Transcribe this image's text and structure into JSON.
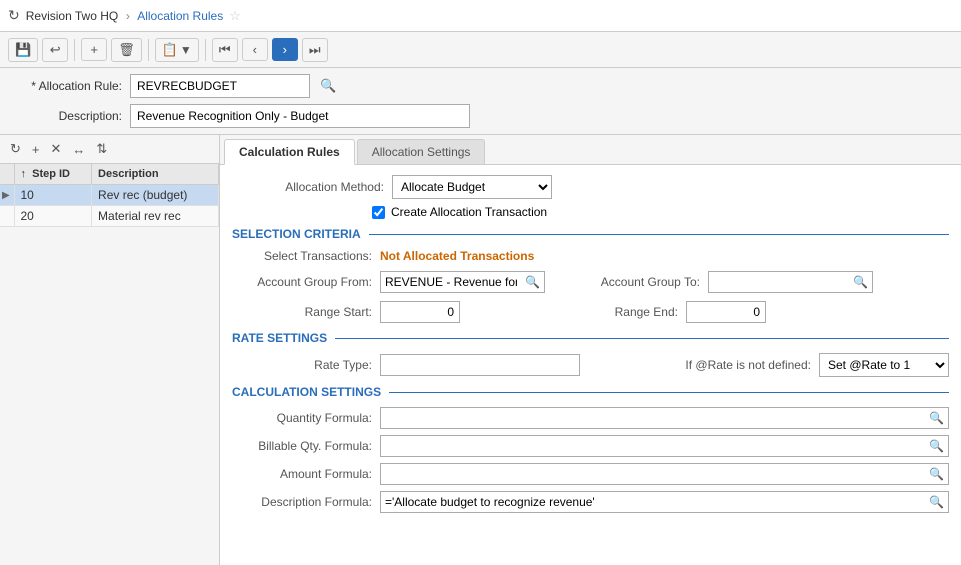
{
  "topbar": {
    "company": "Revision Two HQ",
    "separator": "›",
    "page": "Allocation Rules",
    "star": "☆",
    "refresh_icon": "↻"
  },
  "toolbar": {
    "save": "💾",
    "undo": "↩",
    "add": "+",
    "delete": "🗑",
    "copy_icon": "📋",
    "copy_arrow": "▼",
    "first": "⏮",
    "prev": "‹",
    "next": "›",
    "last": "⏭"
  },
  "header": {
    "rule_label": "* Allocation Rule:",
    "rule_value": "REVRECBUDGET",
    "desc_label": "Description:",
    "desc_value": "Revenue Recognition Only - Budget"
  },
  "left": {
    "toolbar": {
      "refresh": "↻",
      "add": "+",
      "delete": "✕",
      "expand": "↔",
      "sort": "⇅"
    },
    "columns": {
      "arrow": "",
      "step": "↑  Step ID",
      "description": "Description"
    },
    "rows": [
      {
        "selected": true,
        "arrow": "▶",
        "step": "10",
        "description": "Rev rec (budget)"
      },
      {
        "selected": false,
        "arrow": "",
        "step": "20",
        "description": "Material rev rec"
      }
    ]
  },
  "tabs": [
    {
      "id": "calc-rules",
      "label": "Calculation Rules",
      "active": true
    },
    {
      "id": "alloc-settings",
      "label": "Allocation Settings",
      "active": false
    }
  ],
  "calc_rules": {
    "allocation_method_label": "Allocation Method:",
    "allocation_method_value": "Allocate Budget",
    "create_transaction_label": "Create Allocation Transaction",
    "sections": {
      "selection": "SELECTION CRITERIA",
      "rate": "RATE SETTINGS",
      "calculation": "CALCULATION SETTINGS"
    },
    "select_transactions_label": "Select Transactions:",
    "select_transactions_value": "Not Allocated Transactions",
    "account_group_from_label": "Account Group From:",
    "account_group_from_value": "REVENUE - Revenue for p",
    "account_group_to_label": "Account Group To:",
    "account_group_to_value": "",
    "range_start_label": "Range Start:",
    "range_start_value": "0",
    "range_end_label": "Range End:",
    "range_end_value": "0",
    "rate_type_label": "Rate Type:",
    "rate_type_value": "",
    "if_rate_label": "If @Rate is not defined:",
    "if_rate_value": "Set @Rate to 1",
    "quantity_formula_label": "Quantity Formula:",
    "quantity_formula_value": "",
    "billable_qty_label": "Billable Qty. Formula:",
    "billable_qty_value": "",
    "amount_formula_label": "Amount Formula:",
    "amount_formula_value": "",
    "description_formula_label": "Description Formula:",
    "description_formula_value": "='Allocate budget to recognize revenue'"
  }
}
